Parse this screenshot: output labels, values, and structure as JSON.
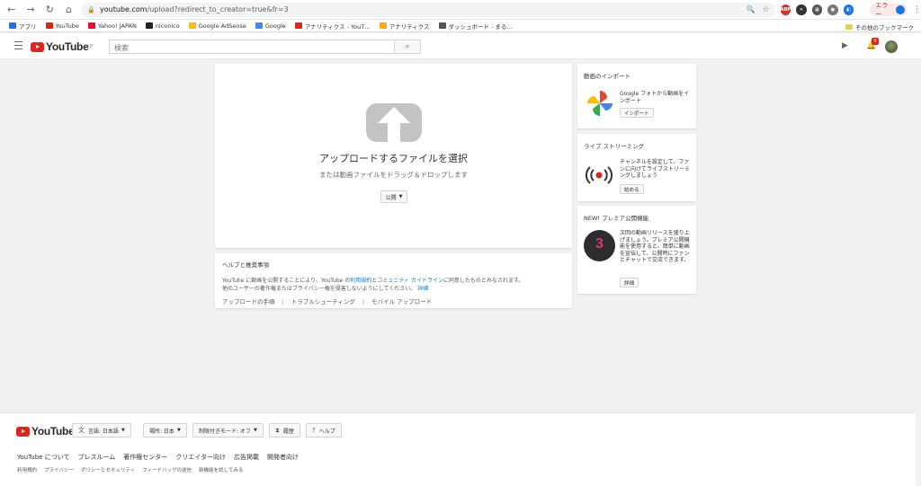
{
  "browser": {
    "url_host": "youtube.com",
    "url_path": "/upload?redirect_to_creator=true&fr=3",
    "error_label": "エラー",
    "bookmarks": [
      {
        "label": "アプリ",
        "color": "#1a73e8"
      },
      {
        "label": "YouTube",
        "color": "#e62117"
      },
      {
        "label": "Yahoo! JAPAN",
        "color": "#ff0033"
      },
      {
        "label": "niconico",
        "color": "#222222"
      },
      {
        "label": "Google AdSense",
        "color": "#fbbc04"
      },
      {
        "label": "Google",
        "color": "#4285f4"
      },
      {
        "label": "アナリティクス - YouT…",
        "color": "#e62117"
      },
      {
        "label": "アナリティクス",
        "color": "#f9ab00"
      },
      {
        "label": "ダッシュボード - まる…",
        "color": "#555555"
      }
    ],
    "other_bookmarks": "その他のブックマーク"
  },
  "header": {
    "logo_text": "YouTube",
    "logo_region": "JP",
    "search_placeholder": "検索",
    "notification_count": "9"
  },
  "upload": {
    "title": "アップロードするファイルを選択",
    "subtitle": "または動画ファイルをドラッグ＆ドロップします",
    "privacy_label": "公開"
  },
  "help": {
    "title": "ヘルプと推奨事項",
    "text_prefix": "YouTube に動画を公開することにより、YouTube の",
    "terms_link": "利用規約",
    "and": "と",
    "guidelines_link": "コミュニティ ガイドライン",
    "text_suffix": "に同意したものとみなされます。",
    "text_line2": "他のユーザーの著作権またはプライバシー権を侵害しないようにしてください。",
    "details_link": "詳細",
    "links": [
      "アップロードの手順",
      "トラブルシューティング",
      "モバイル アップロード"
    ]
  },
  "cards": {
    "import": {
      "title": "動画のインポート",
      "text": "Google フォトから動画をインポート",
      "button": "インポート"
    },
    "live": {
      "title": "ライブ ストリーミング",
      "text": "チャンネルを設定して、ファンに向けてライブストリーミングしましょう",
      "button": "始める"
    },
    "premiere": {
      "title": "NEW! プレミア公開機能",
      "text": "次回の動画リリースを盛り上げましょう。プレミア公開機能を使用すると、簡単に動画を宣伝して、公開時にファンとチャットで交流できます。",
      "button": "詳細",
      "countdown": "3"
    }
  },
  "footer": {
    "logo_text": "YouTube",
    "buttons": {
      "language": "言語: 日本語",
      "location": "場所: 日本",
      "restricted": "制限付きモード: オフ",
      "history": "履歴",
      "help": "ヘルプ"
    },
    "links1": [
      "YouTube について",
      "プレスルーム",
      "著作権センター",
      "クリエイター向け",
      "広告掲載",
      "開発者向け"
    ],
    "links2": [
      "利用規約",
      "プライバシー",
      "ポリシーとセキュリティ",
      "フィードバックの送信",
      "新機能を試してみる"
    ]
  }
}
